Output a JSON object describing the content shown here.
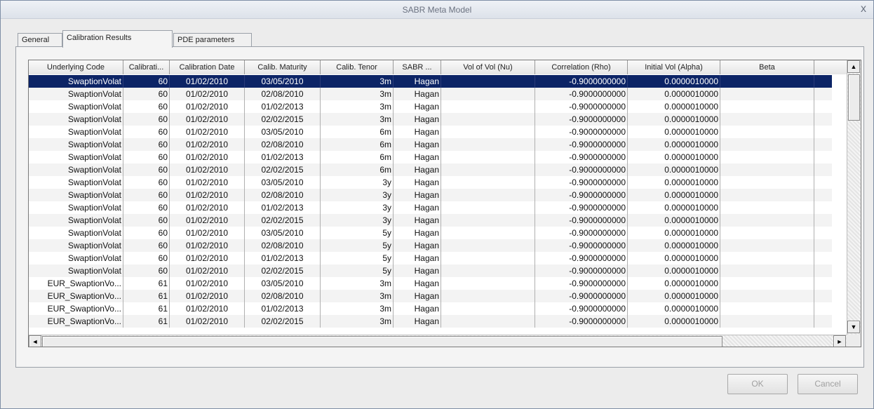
{
  "window": {
    "title": "SABR Meta Model",
    "close_label": "x"
  },
  "tabs": [
    {
      "label": "General",
      "active": false
    },
    {
      "label": "Calibration Results",
      "active": true
    },
    {
      "label": "PDE parameters",
      "active": false
    }
  ],
  "grid": {
    "columns": [
      "Underlying Code",
      "Calibrati...",
      "Calibration Date",
      "Calib. Maturity",
      "Calib. Tenor",
      "SABR ...",
      "Vol of Vol (Nu)",
      "Correlation (Rho)",
      "Initial Vol (Alpha)",
      "Beta"
    ],
    "selected_row": 0,
    "rows": [
      [
        "SwaptionVolat",
        "60",
        "01/02/2010",
        "03/05/2010",
        "3m",
        "Hagan",
        "",
        "-0.9000000000",
        "0.0000010000",
        ""
      ],
      [
        "SwaptionVolat",
        "60",
        "01/02/2010",
        "02/08/2010",
        "3m",
        "Hagan",
        "",
        "-0.9000000000",
        "0.0000010000",
        ""
      ],
      [
        "SwaptionVolat",
        "60",
        "01/02/2010",
        "01/02/2013",
        "3m",
        "Hagan",
        "",
        "-0.9000000000",
        "0.0000010000",
        ""
      ],
      [
        "SwaptionVolat",
        "60",
        "01/02/2010",
        "02/02/2015",
        "3m",
        "Hagan",
        "",
        "-0.9000000000",
        "0.0000010000",
        ""
      ],
      [
        "SwaptionVolat",
        "60",
        "01/02/2010",
        "03/05/2010",
        "6m",
        "Hagan",
        "",
        "-0.9000000000",
        "0.0000010000",
        ""
      ],
      [
        "SwaptionVolat",
        "60",
        "01/02/2010",
        "02/08/2010",
        "6m",
        "Hagan",
        "",
        "-0.9000000000",
        "0.0000010000",
        ""
      ],
      [
        "SwaptionVolat",
        "60",
        "01/02/2010",
        "01/02/2013",
        "6m",
        "Hagan",
        "",
        "-0.9000000000",
        "0.0000010000",
        ""
      ],
      [
        "SwaptionVolat",
        "60",
        "01/02/2010",
        "02/02/2015",
        "6m",
        "Hagan",
        "",
        "-0.9000000000",
        "0.0000010000",
        ""
      ],
      [
        "SwaptionVolat",
        "60",
        "01/02/2010",
        "03/05/2010",
        "3y",
        "Hagan",
        "",
        "-0.9000000000",
        "0.0000010000",
        ""
      ],
      [
        "SwaptionVolat",
        "60",
        "01/02/2010",
        "02/08/2010",
        "3y",
        "Hagan",
        "",
        "-0.9000000000",
        "0.0000010000",
        ""
      ],
      [
        "SwaptionVolat",
        "60",
        "01/02/2010",
        "01/02/2013",
        "3y",
        "Hagan",
        "",
        "-0.9000000000",
        "0.0000010000",
        ""
      ],
      [
        "SwaptionVolat",
        "60",
        "01/02/2010",
        "02/02/2015",
        "3y",
        "Hagan",
        "",
        "-0.9000000000",
        "0.0000010000",
        ""
      ],
      [
        "SwaptionVolat",
        "60",
        "01/02/2010",
        "03/05/2010",
        "5y",
        "Hagan",
        "",
        "-0.9000000000",
        "0.0000010000",
        ""
      ],
      [
        "SwaptionVolat",
        "60",
        "01/02/2010",
        "02/08/2010",
        "5y",
        "Hagan",
        "",
        "-0.9000000000",
        "0.0000010000",
        ""
      ],
      [
        "SwaptionVolat",
        "60",
        "01/02/2010",
        "01/02/2013",
        "5y",
        "Hagan",
        "",
        "-0.9000000000",
        "0.0000010000",
        ""
      ],
      [
        "SwaptionVolat",
        "60",
        "01/02/2010",
        "02/02/2015",
        "5y",
        "Hagan",
        "",
        "-0.9000000000",
        "0.0000010000",
        ""
      ],
      [
        "EUR_SwaptionVo...",
        "61",
        "01/02/2010",
        "03/05/2010",
        "3m",
        "Hagan",
        "",
        "-0.9000000000",
        "0.0000010000",
        ""
      ],
      [
        "EUR_SwaptionVo...",
        "61",
        "01/02/2010",
        "02/08/2010",
        "3m",
        "Hagan",
        "",
        "-0.9000000000",
        "0.0000010000",
        ""
      ],
      [
        "EUR_SwaptionVo...",
        "61",
        "01/02/2010",
        "01/02/2013",
        "3m",
        "Hagan",
        "",
        "-0.9000000000",
        "0.0000010000",
        ""
      ],
      [
        "EUR_SwaptionVo...",
        "61",
        "01/02/2010",
        "02/02/2015",
        "3m",
        "Hagan",
        "",
        "-0.9000000000",
        "0.0000010000",
        ""
      ]
    ]
  },
  "buttons": {
    "ok": "OK",
    "cancel": "Cancel"
  }
}
